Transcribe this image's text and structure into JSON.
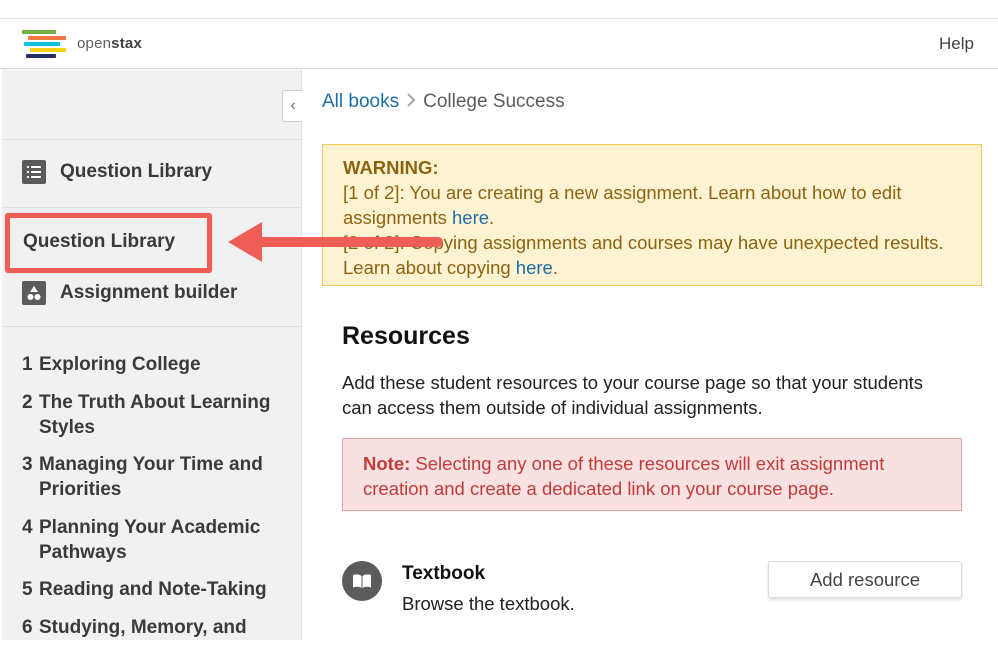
{
  "header": {
    "brand_light": "open",
    "brand_bold": "stax",
    "help_label": "Help"
  },
  "sidebar": {
    "collapse_glyph": "‹",
    "nav_items": [
      {
        "label": "Question Library",
        "icon": "list-icon"
      },
      {
        "label": "Assignment builder",
        "icon": "shapes-icon"
      }
    ],
    "chapters": [
      {
        "num": "1",
        "title": "Exploring College"
      },
      {
        "num": "2",
        "title": "The Truth About Learning Styles"
      },
      {
        "num": "3",
        "title": "Managing Your Time and Priorities"
      },
      {
        "num": "4",
        "title": "Planning Your Academic Pathways"
      },
      {
        "num": "5",
        "title": "Reading and Note-Taking"
      },
      {
        "num": "6",
        "title": "Studying, Memory, and"
      }
    ]
  },
  "annotation": {
    "callout_label": "Question Library",
    "color": "#ef5e56"
  },
  "breadcrumb": {
    "root": "All books",
    "current": "College Success"
  },
  "warning": {
    "title": "WARNING:",
    "line1_text": "[1 of 2]: You are creating a new assignment. Learn about how to edit assignments ",
    "line1_link": "here",
    "line2_text": "[2 of 2]: Copying assignments and courses may have unexpected results. Learn about copying ",
    "line2_link": "here"
  },
  "resources": {
    "title": "Resources",
    "description": "Add these student resources to your course page so that your students can access them outside of individual assignments.",
    "note_label": "Note:",
    "note_text": " Selecting any one of these resources will exit assignment creation and create a dedicated link on your course page.",
    "items": [
      {
        "icon": "book-icon",
        "title": "Textbook",
        "description": "Browse the textbook.",
        "button_label": "Add resource"
      }
    ]
  },
  "colors": {
    "link": "#1f6fa6",
    "warning_bg": "#fdf3d3",
    "warning_text": "#8c6410",
    "note_bg": "#f9e1e1",
    "note_text": "#c23b3b",
    "sidebar_bg": "#f1f1f1"
  }
}
